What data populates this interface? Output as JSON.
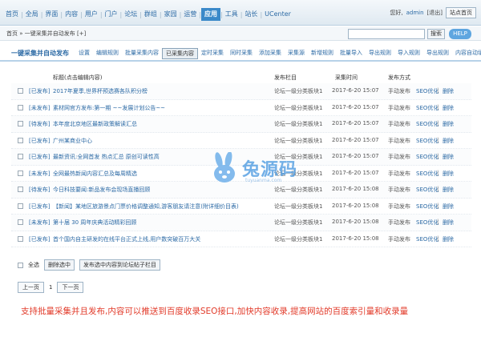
{
  "topnav": {
    "items": [
      "首页",
      "全局",
      "界面",
      "内容",
      "用户",
      "门户",
      "论坛",
      "群组",
      "家园",
      "运营",
      "应用",
      "工具",
      "站长",
      "UCenter"
    ],
    "active_index": 10
  },
  "user": {
    "greeting": "您好,",
    "name": "admin",
    "logout": "[退出]",
    "home_btn": "站点首页"
  },
  "crumb": {
    "text": "首页 » 一键采集并自动发布 [+]",
    "search_btn": "搜索",
    "help_btn": "HELP"
  },
  "module": {
    "title": "一键采集并自动发布",
    "tabs": [
      "设置",
      "编辑规则",
      "批量采集内容",
      "已采集内容",
      "定时采集",
      "同时采集",
      "添加采集",
      "采集源",
      "新增规则",
      "批量导入",
      "导出规则",
      "导入规则",
      "导出规则",
      "内容自动填充"
    ],
    "active_index": 3
  },
  "table": {
    "headers": {
      "title": "标题(点击编辑内容)",
      "category": "发布栏目",
      "time": "采集时间",
      "way": "发布方式"
    },
    "rows": [
      {
        "tag": "[已发布]",
        "title": "2017年夏季,世界杯预选赛各队积分榜",
        "category": "论坛一级分类板块1",
        "time": "2017-6-20 15:07",
        "way": "手动发布",
        "seo": "SEO优化",
        "del": "删除"
      },
      {
        "tag": "[未发布]",
        "title": "素材网官方发布:第一期 ~~发展计划公告~~",
        "category": "论坛一级分类板块1",
        "time": "2017-6-20 15:07",
        "way": "手动发布",
        "seo": "SEO优化",
        "del": "删除"
      },
      {
        "tag": "[待发布]",
        "title": "本年度北京地区最新政策解读汇总",
        "category": "论坛一级分类板块1",
        "time": "2017-6-20 15:07",
        "way": "手动发布",
        "seo": "SEO优化",
        "del": "删除"
      },
      {
        "tag": "[已发布]",
        "title": "广州某商业中心",
        "category": "论坛一级分类板块1",
        "time": "2017-6-20 15:07",
        "way": "手动发布",
        "seo": "SEO优化",
        "del": "删除"
      },
      {
        "tag": "[已发布]",
        "title": "最新资讯:全网首发 热点汇总 原创可读性高",
        "category": "论坛一级分类板块1",
        "time": "2017-6-20 15:07",
        "way": "手动发布",
        "seo": "SEO优化",
        "del": "删除"
      },
      {
        "tag": "[未发布]",
        "title": "全网最热新闻内容汇总及每周精选",
        "category": "论坛一级分类板块1",
        "time": "2017-6-20 15:07",
        "way": "手动发布",
        "seo": "SEO优化",
        "del": "删除"
      },
      {
        "tag": "[待发布]",
        "title": "今日科技要闻:新品发布会现场直播回顾",
        "category": "论坛一级分类板块1",
        "time": "2017-6-20 15:08",
        "way": "手动发布",
        "seo": "SEO优化",
        "del": "删除"
      },
      {
        "tag": "[已发布]",
        "title": "【新闻】某地区旅游景点门票价格调整通知,游客朋友请注意(附详细价目表)",
        "category": "论坛一级分类板块1",
        "time": "2017-6-20 15:08",
        "way": "手动发布",
        "seo": "SEO优化",
        "del": "删除"
      },
      {
        "tag": "[未发布]",
        "title": "第十届 30 周年庆典活动精彩回顾",
        "category": "论坛一级分类板块1",
        "time": "2017-6-20 15:08",
        "way": "手动发布",
        "seo": "SEO优化",
        "del": "删除"
      },
      {
        "tag": "[已发布]",
        "title": "首个国内自主研发的在线平台正式上线,用户数突破百万大关",
        "category": "论坛一级分类板块1",
        "time": "2017-6-20 15:08",
        "way": "手动发布",
        "seo": "SEO优化",
        "del": "删除"
      }
    ]
  },
  "actions": {
    "select_all": "全选",
    "delete_btn": "删除选中",
    "publish_btn": "发布选中内容到论坛帖子栏目"
  },
  "pager": {
    "prev": "上一页",
    "current": "1",
    "next": "下一页"
  },
  "note": "支持批量采集并且发布,内容可以推送到百度收录SEO接口,加快内容收录,提高网站的百度索引量和收录量",
  "watermark": {
    "text": "兔源码",
    "sub": "tuyuanma.com"
  }
}
